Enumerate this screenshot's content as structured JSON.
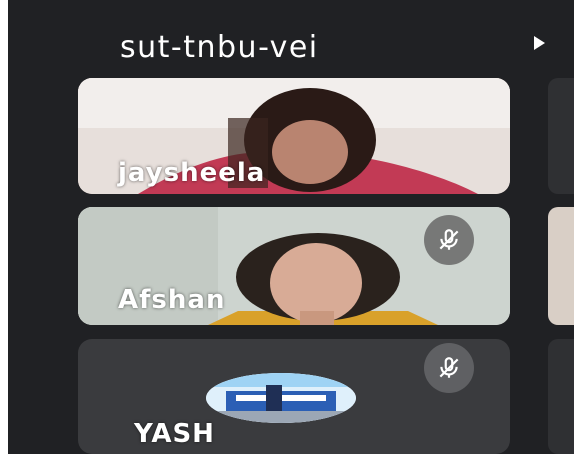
{
  "meeting": {
    "title": "sut-tnbu-vei"
  },
  "participants": [
    {
      "name": "jaysheela",
      "muted": false
    },
    {
      "name": "Afshan",
      "muted": true,
      "mute_icon": "mic-off-icon"
    },
    {
      "name": "YASH",
      "muted": true,
      "mute_icon": "mic-off-icon"
    }
  ],
  "colors": {
    "background": "#202124",
    "name_text": "#ffffff",
    "badge": "#5f6063"
  }
}
